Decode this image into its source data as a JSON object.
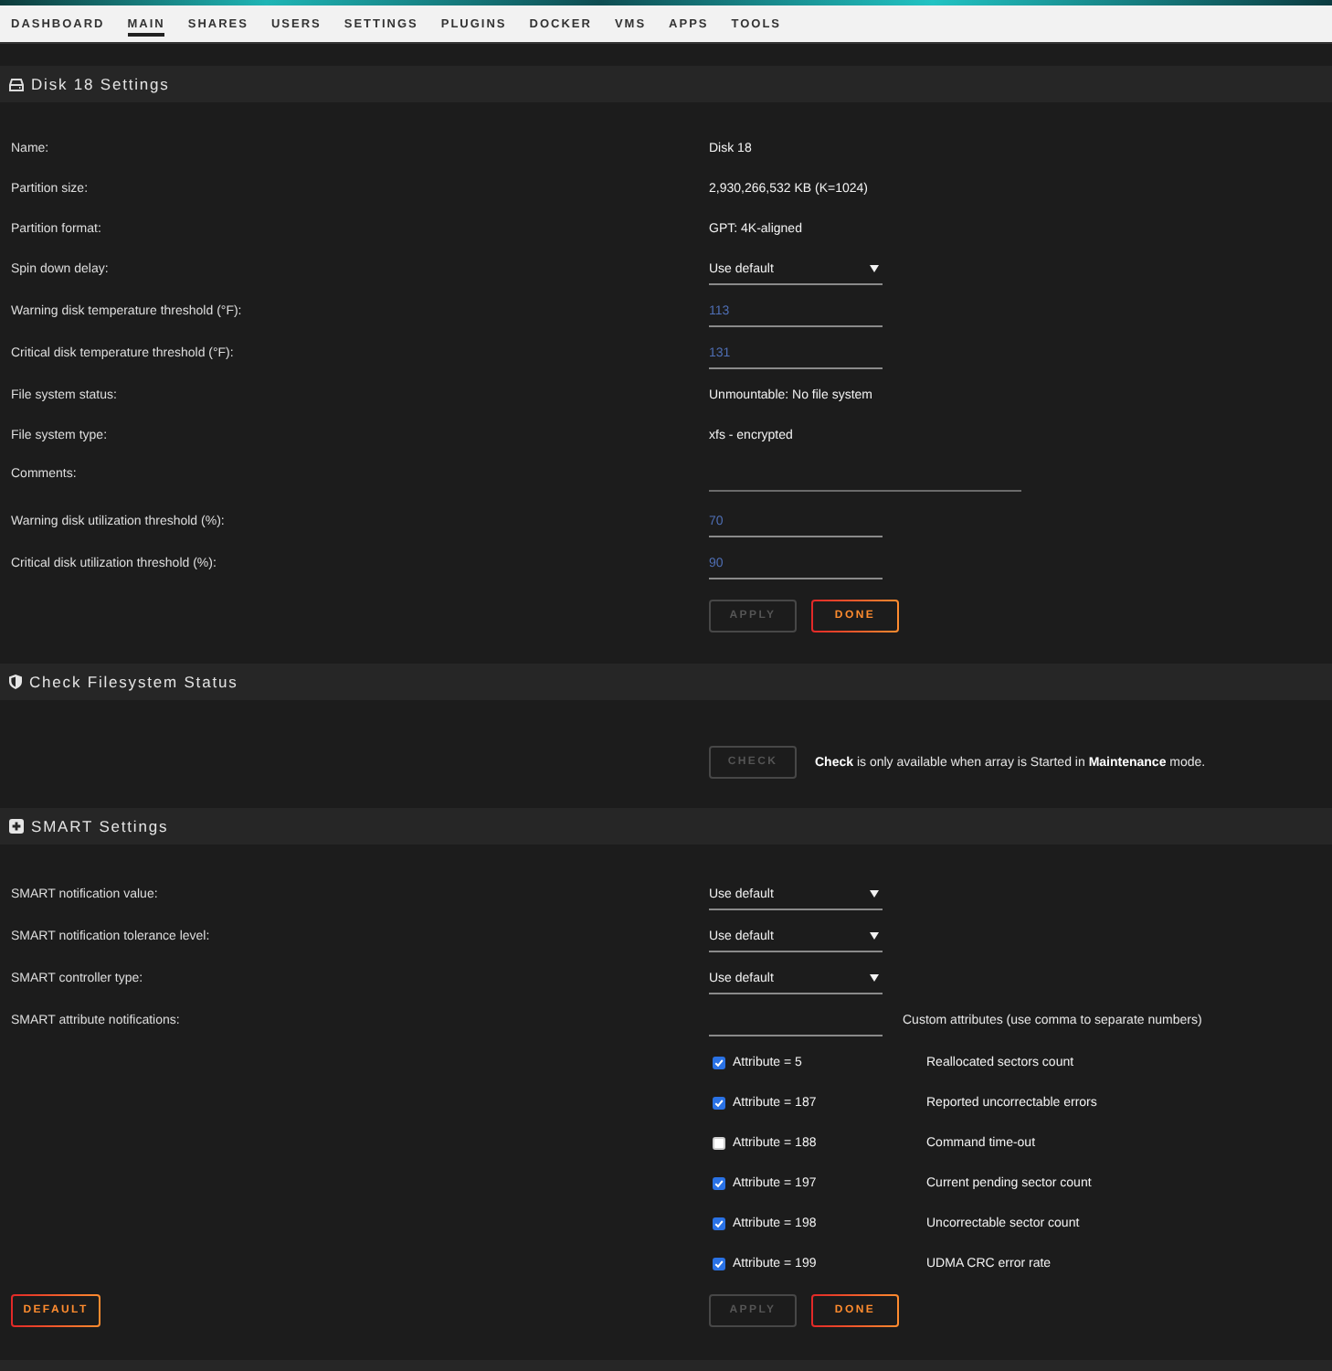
{
  "nav": [
    {
      "label": "DASHBOARD",
      "selected": false
    },
    {
      "label": "MAIN",
      "selected": true
    },
    {
      "label": "SHARES",
      "selected": false
    },
    {
      "label": "USERS",
      "selected": false
    },
    {
      "label": "SETTINGS",
      "selected": false
    },
    {
      "label": "PLUGINS",
      "selected": false
    },
    {
      "label": "DOCKER",
      "selected": false
    },
    {
      "label": "VMS",
      "selected": false
    },
    {
      "label": "APPS",
      "selected": false
    },
    {
      "label": "TOOLS",
      "selected": false
    }
  ],
  "disk_settings": {
    "title": "Disk 18 Settings",
    "rows": [
      {
        "label": "Name:",
        "kind": "text",
        "value": "Disk 18"
      },
      {
        "label": "Partition size:",
        "kind": "text",
        "value": "2,930,266,532 KB (K=1024)"
      },
      {
        "label": "Partition format:",
        "kind": "text",
        "value": "GPT: 4K-aligned"
      },
      {
        "label": "Spin down delay:",
        "kind": "select",
        "value": "Use default"
      },
      {
        "label": "Warning disk temperature threshold (°F):",
        "kind": "input",
        "value": "113"
      },
      {
        "label": "Critical disk temperature threshold (°F):",
        "kind": "input",
        "value": "131"
      },
      {
        "label": "File system status:",
        "kind": "text",
        "value": "Unmountable: No file system"
      },
      {
        "label": "File system type:",
        "kind": "text",
        "value": "xfs - encrypted"
      },
      {
        "label": "Comments:",
        "kind": "textbox"
      },
      {
        "label": "Warning disk utilization threshold (%):",
        "kind": "input",
        "value": "70"
      },
      {
        "label": "Critical disk utilization threshold (%):",
        "kind": "input",
        "value": "90"
      }
    ],
    "buttons": [
      {
        "label": "APPLY",
        "disabled": true
      },
      {
        "label": "DONE",
        "disabled": false
      }
    ]
  },
  "check_filesystem": {
    "title": "Check Filesystem Status",
    "button": {
      "label": "CHECK",
      "disabled": true
    },
    "note": "**Check** is only available when array is Started in **Maintenance** mode."
  },
  "smart_settings": {
    "title": "SMART Settings",
    "rows": [
      {
        "label": "SMART notification value:",
        "kind": "select",
        "value": "Use default"
      },
      {
        "label": "SMART notification tolerance level:",
        "kind": "select",
        "value": "Use default"
      },
      {
        "label": "SMART controller type:",
        "kind": "select",
        "value": "Use default"
      },
      {
        "label": "SMART attribute notifications:",
        "kind": "custom",
        "note": "Custom attributes (use comma to separate numbers)"
      }
    ],
    "attributes": [
      {
        "label": "Attribute = 5",
        "checked": true,
        "description": "Reallocated sectors count"
      },
      {
        "label": "Attribute = 187",
        "checked": true,
        "description": "Reported uncorrectable errors"
      },
      {
        "label": "Attribute = 188",
        "checked": false,
        "description": "Command time-out"
      },
      {
        "label": "Attribute = 197",
        "checked": true,
        "description": "Current pending sector count"
      },
      {
        "label": "Attribute = 198",
        "checked": true,
        "description": "Uncorrectable sector count"
      },
      {
        "label": "Attribute = 199",
        "checked": true,
        "description": "UDMA CRC error rate"
      }
    ],
    "default_button": {
      "label": "DEFAULT",
      "disabled": false
    },
    "buttons": [
      {
        "label": "APPLY",
        "disabled": true
      },
      {
        "label": "DONE",
        "disabled": false
      }
    ]
  }
}
